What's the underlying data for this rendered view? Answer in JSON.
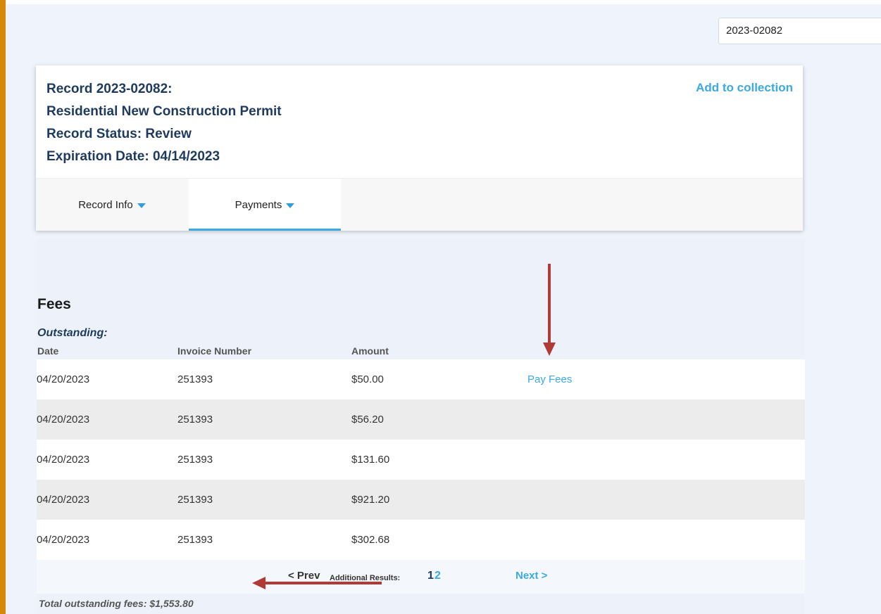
{
  "search": {
    "value": "2023-02082"
  },
  "record": {
    "line1": "Record 2023-02082:",
    "line2": "Residential New Construction Permit",
    "line3": "Record Status: Review",
    "line4": "Expiration Date: 04/14/2023",
    "add_to_collection": "Add to collection"
  },
  "tabs": [
    {
      "label": "Record Info"
    },
    {
      "label": "Payments"
    }
  ],
  "fees": {
    "title": "Fees",
    "outstanding_label": "Outstanding:",
    "columns": [
      "Date",
      "Invoice Number",
      "Amount"
    ],
    "pay_fees_label": "Pay Fees",
    "rows": [
      {
        "date": "04/20/2023",
        "invoice": "251393",
        "amount": "$50.00"
      },
      {
        "date": "04/20/2023",
        "invoice": "251393",
        "amount": "$56.20"
      },
      {
        "date": "04/20/2023",
        "invoice": "251393",
        "amount": "$131.60"
      },
      {
        "date": "04/20/2023",
        "invoice": "251393",
        "amount": "$921.20"
      },
      {
        "date": "04/20/2023",
        "invoice": "251393",
        "amount": "$302.68"
      }
    ],
    "pager": {
      "prev": "< Prev",
      "additional_results": "Additional Results:",
      "pages": [
        "1",
        "2"
      ],
      "next": "Next >"
    },
    "total": "Total outstanding fees: $1,553.80"
  },
  "colors": {
    "accent": "#3ba9e2",
    "heading": "#1e3a5c",
    "left_border": "#d4890a",
    "annotation_arrow": "#b03a36"
  }
}
